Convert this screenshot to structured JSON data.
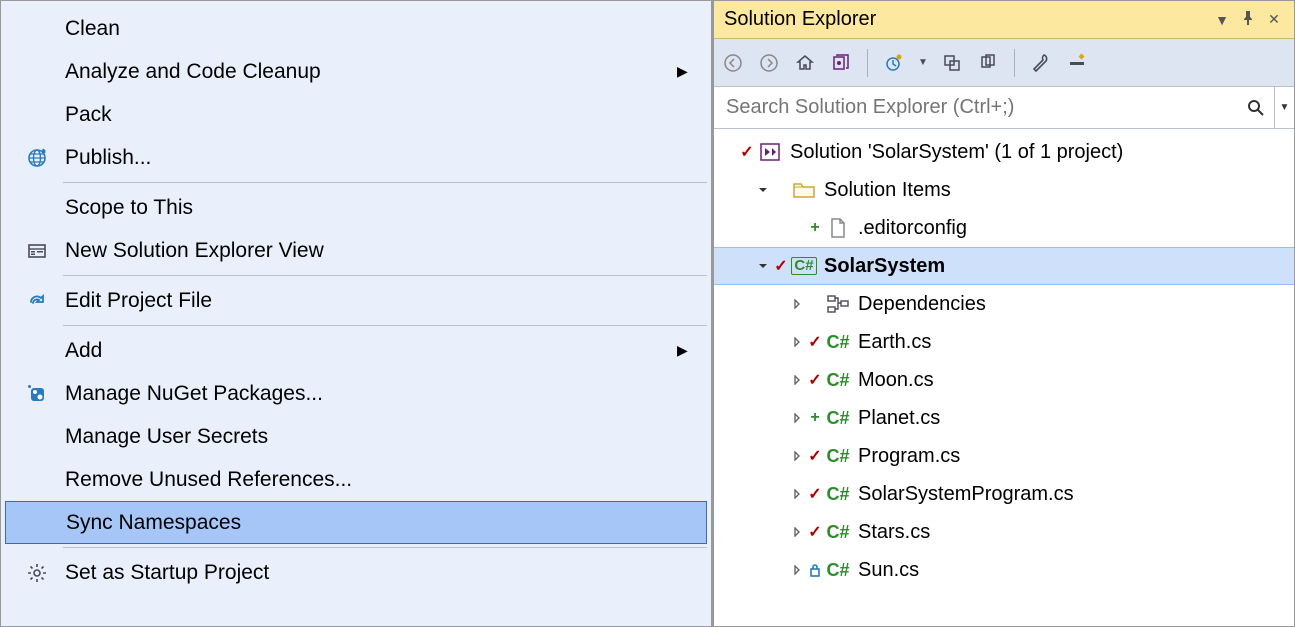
{
  "contextMenu": {
    "items": [
      {
        "label": "Clean",
        "icon": null,
        "submenu": false
      },
      {
        "label": "Analyze and Code Cleanup",
        "icon": null,
        "submenu": true
      },
      {
        "label": "Pack",
        "icon": null,
        "submenu": false
      },
      {
        "label": "Publish...",
        "icon": "globe",
        "submenu": false
      },
      {
        "sep": true
      },
      {
        "label": "Scope to This",
        "icon": null,
        "submenu": false
      },
      {
        "label": "New Solution Explorer View",
        "icon": "explorer",
        "submenu": false
      },
      {
        "sep": true
      },
      {
        "label": "Edit Project File",
        "icon": "redo",
        "submenu": false
      },
      {
        "sep": true
      },
      {
        "label": "Add",
        "icon": null,
        "submenu": true
      },
      {
        "label": "Manage NuGet Packages...",
        "icon": "nuget",
        "submenu": false
      },
      {
        "label": "Manage User Secrets",
        "icon": null,
        "submenu": false
      },
      {
        "label": "Remove Unused References...",
        "icon": null,
        "submenu": false
      },
      {
        "label": "Sync Namespaces",
        "icon": null,
        "submenu": false,
        "selected": true
      },
      {
        "sep": true
      },
      {
        "label": "Set as Startup Project",
        "icon": "gear",
        "submenu": false
      }
    ]
  },
  "solutionExplorer": {
    "title": "Solution Explorer",
    "searchPlaceholder": "Search Solution Explorer (Ctrl+;)",
    "tree": [
      {
        "depth": 0,
        "expand": "none",
        "status": "check",
        "icon": "vs",
        "label": "Solution 'SolarSystem' (1 of 1 project)"
      },
      {
        "depth": 1,
        "expand": "open",
        "status": "",
        "icon": "folder",
        "label": "Solution Items"
      },
      {
        "depth": 2,
        "expand": "none",
        "status": "plus",
        "icon": "file",
        "label": ".editorconfig"
      },
      {
        "depth": 1,
        "expand": "open",
        "status": "check",
        "icon": "csproj",
        "label": "SolarSystem",
        "selected": true
      },
      {
        "depth": 2,
        "expand": "closed",
        "status": "",
        "icon": "deps",
        "label": "Dependencies"
      },
      {
        "depth": 2,
        "expand": "closed",
        "status": "check",
        "icon": "cs",
        "label": "Earth.cs"
      },
      {
        "depth": 2,
        "expand": "closed",
        "status": "check",
        "icon": "cs",
        "label": "Moon.cs"
      },
      {
        "depth": 2,
        "expand": "closed",
        "status": "plus",
        "icon": "cs",
        "label": "Planet.cs"
      },
      {
        "depth": 2,
        "expand": "closed",
        "status": "check",
        "icon": "cs",
        "label": "Program.cs"
      },
      {
        "depth": 2,
        "expand": "closed",
        "status": "check",
        "icon": "cs",
        "label": "SolarSystemProgram.cs"
      },
      {
        "depth": 2,
        "expand": "closed",
        "status": "check",
        "icon": "cs",
        "label": "Stars.cs"
      },
      {
        "depth": 2,
        "expand": "closed",
        "status": "lock",
        "icon": "cs",
        "label": "Sun.cs"
      }
    ]
  }
}
